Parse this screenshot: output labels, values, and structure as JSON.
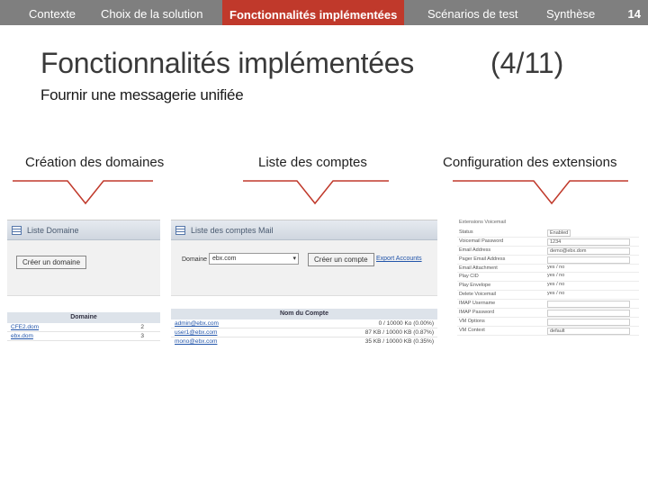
{
  "nav": {
    "items": [
      "Contexte",
      "Choix de la solution",
      "Fonctionnalités implémentées",
      "Scénarios de test",
      "Synthèse"
    ],
    "active_index": 2,
    "page_number": "14"
  },
  "slide": {
    "title": "Fonctionnalités implémentées",
    "counter": "(4/11)",
    "subtitle": "Fournir une messagerie unifiée"
  },
  "sections": {
    "domains_label": "Création des domaines",
    "accounts_label": "Liste des comptes",
    "extensions_label": "Configuration des extensions"
  },
  "domains_shot": {
    "header": "Liste Domaine",
    "create_button": "Créer un domaine",
    "column": "Domaine",
    "rows": [
      {
        "name": "CFE2.dom",
        "count": "2"
      },
      {
        "name": "ebx.dom",
        "count": "3"
      }
    ]
  },
  "accounts_shot": {
    "header": "Liste des comptes Mail",
    "domain_label": "Domaine",
    "domain_value": "ebx.com",
    "create_button": "Créer un compte",
    "export_link": "Export Accounts",
    "column": "Nom du Compte",
    "rows": [
      {
        "name": "admin@ebx.com",
        "quota": "0 / 10000 Ko (0.00%)"
      },
      {
        "name": "user1@ebx.com",
        "quota": "87 KB / 10000 KB (0.87%)"
      },
      {
        "name": "mono@ebx.com",
        "quota": "35 KB / 10000 KB (0.35%)"
      }
    ]
  },
  "extensions_shot": {
    "heading": "Extensions Voicemail",
    "rows": [
      {
        "key": "Status",
        "value": "Enabled"
      },
      {
        "key": "Voicemail Password",
        "value": "1234"
      },
      {
        "key": "Email Address",
        "value": "demo@ebx.dom"
      },
      {
        "key": "Pager Email Address",
        "value": ""
      },
      {
        "key": "Email Attachment",
        "value": "yes / no"
      },
      {
        "key": "Play CID",
        "value": "yes / no"
      },
      {
        "key": "Play Envelope",
        "value": "yes / no"
      },
      {
        "key": "Delete Voicemail",
        "value": "yes / no"
      },
      {
        "key": "IMAP Username",
        "value": ""
      },
      {
        "key": "IMAP Password",
        "value": ""
      },
      {
        "key": "VM Options",
        "value": ""
      },
      {
        "key": "VM Context",
        "value": "default"
      }
    ]
  },
  "colors": {
    "nav_bg": "#7f7f7f",
    "accent": "#c0392b"
  }
}
